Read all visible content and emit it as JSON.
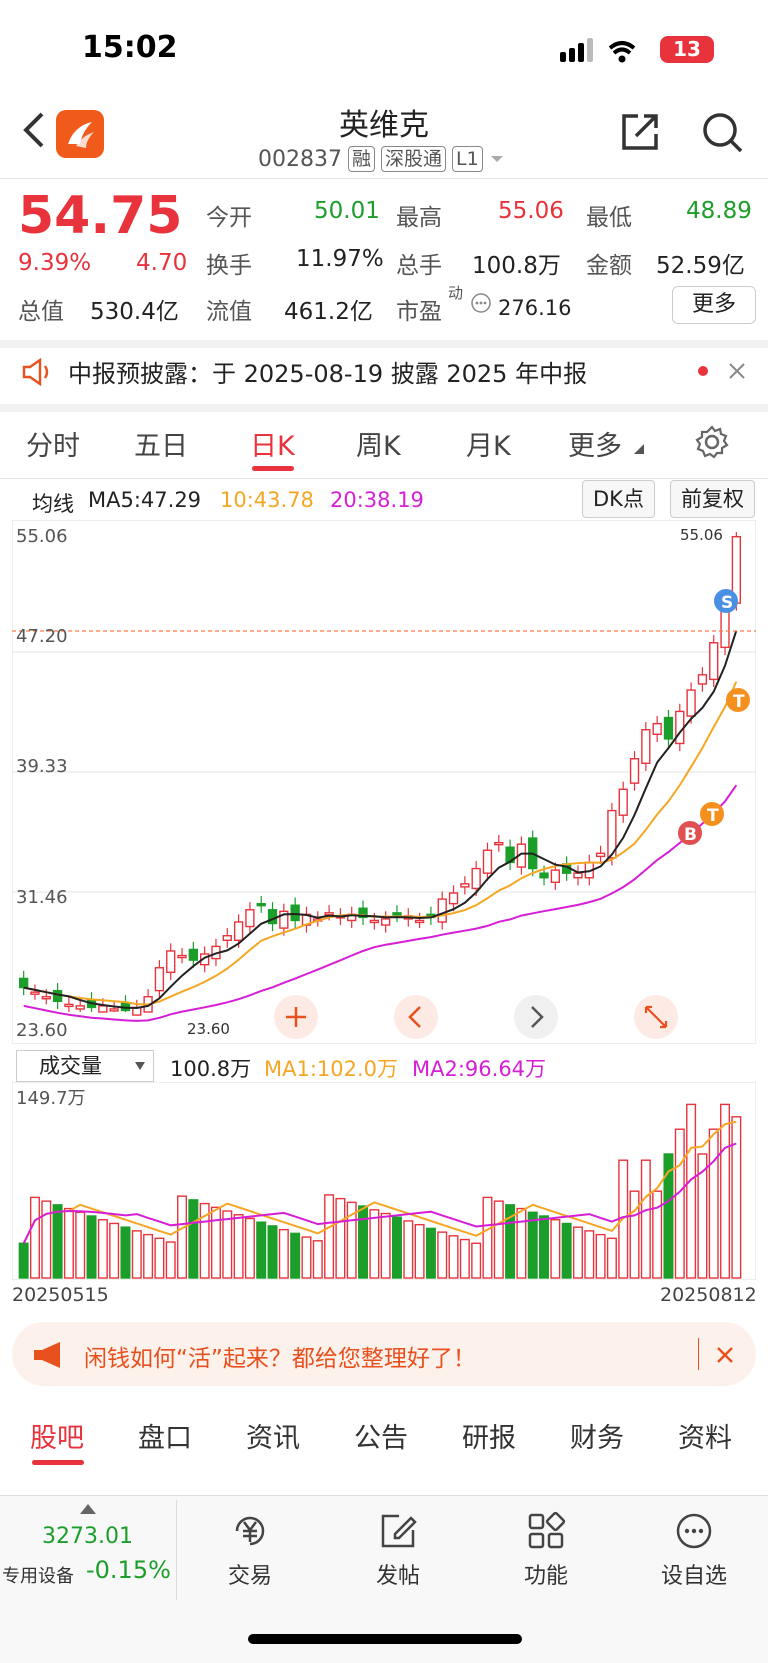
{
  "status": {
    "time": "15:02",
    "battery": "13"
  },
  "header": {
    "title": "英维克",
    "code": "002837",
    "tags": [
      "融",
      "深股通",
      "L1"
    ]
  },
  "quote": {
    "price": "54.75",
    "pct": "9.39%",
    "change": "4.70",
    "rows": [
      [
        {
          "label": "今开",
          "value": "50.01",
          "color": "green"
        },
        {
          "label": "最高",
          "value": "55.06",
          "color": "red"
        },
        {
          "label": "最低",
          "value": "48.89",
          "color": "green"
        }
      ],
      [
        {
          "label": "换手",
          "value": "11.97%",
          "color": "dark"
        },
        {
          "label": "总手",
          "value": "100.8万",
          "color": "dark"
        },
        {
          "label": "金额",
          "value": "52.59亿",
          "color": "dark"
        }
      ]
    ],
    "cap_label": "总值",
    "cap_value": "530.4亿",
    "float_label": "流值",
    "float_value": "461.2亿",
    "pe_label": "市盈",
    "pe_sup": "动",
    "pe_value": "276.16",
    "more": "更多"
  },
  "notice": {
    "text": "中报预披露：于 2025-08-19 披露 2025 年中报"
  },
  "tabs": [
    "分时",
    "五日",
    "日K",
    "周K",
    "月K",
    "更多"
  ],
  "ma_legend": {
    "label": "均线",
    "ma5": "MA5:47.29",
    "ma10": "10:43.78",
    "ma20": "20:38.19",
    "dk": "DK点",
    "adj": "前复权"
  },
  "kline": {
    "price_labels": [
      "55.06",
      "47.20",
      "39.33",
      "31.46",
      "23.60"
    ],
    "high_marker": "55.06",
    "low_marker": "23.60"
  },
  "volume": {
    "select": "成交量",
    "value": "100.8万",
    "ma1": "MA1:102.0万",
    "ma2": "MA2:96.64万",
    "max_label": "149.7万",
    "date_start": "20250515",
    "date_end": "20250812"
  },
  "ad": {
    "text": "闲钱如何“活”起来？都给您整理好了！"
  },
  "bottom_tabs": [
    "股吧",
    "盘口",
    "资讯",
    "公告",
    "研报",
    "财务",
    "资料"
  ],
  "index": {
    "value": "3273.01",
    "label": "专用设备",
    "change": "-0.15%"
  },
  "bottom_bar": [
    "交易",
    "发帖",
    "功能",
    "设自选"
  ],
  "colors": {
    "up": "#e8323c",
    "down": "#1b9e2a",
    "ma5": "#222222",
    "ma10": "#f5a623",
    "ma20": "#d61ed6"
  },
  "chart_data": {
    "type": "candlestick",
    "ylim": [
      23.6,
      55.06
    ],
    "closes": [
      25.2,
      24.9,
      24.6,
      24.3,
      24.1,
      24.0,
      23.9,
      24.0,
      23.8,
      23.7,
      23.9,
      24.6,
      26.5,
      27.6,
      27.3,
      27.0,
      27.4,
      27.9,
      28.6,
      29.5,
      30.3,
      30.6,
      29.4,
      30.2,
      29.6,
      30.0,
      29.7,
      30.1,
      29.9,
      30.0,
      29.8,
      29.6,
      29.7,
      30.0,
      29.9,
      29.6,
      29.8,
      31.0,
      31.4,
      32.0,
      33.0,
      34.2,
      34.7,
      33.4,
      34.6,
      33.0,
      32.4,
      32.9,
      32.7,
      32.7,
      33.4,
      34.0,
      36.8,
      38.2,
      40.2,
      42.1,
      42.5,
      41.5,
      43.3,
      44.7,
      45.7,
      47.8,
      50.0,
      54.75
    ],
    "ma5": [],
    "ma10": [],
    "ma20": []
  }
}
